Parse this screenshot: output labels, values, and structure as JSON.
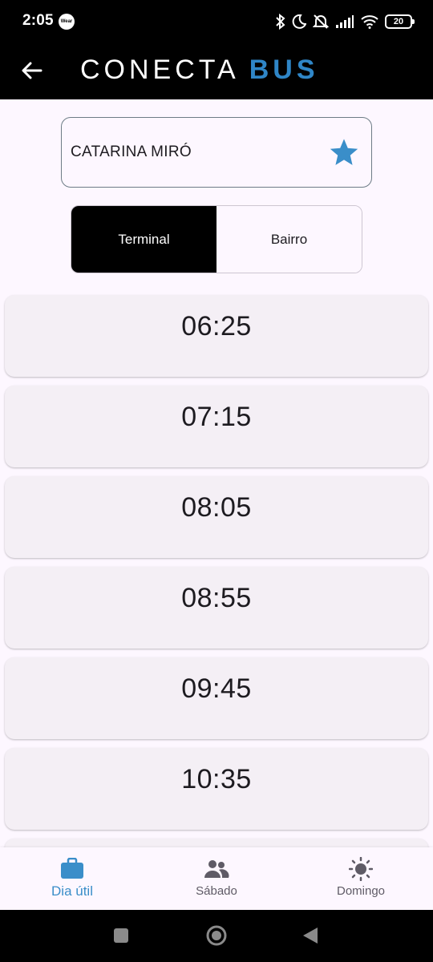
{
  "status_bar": {
    "time": "2:05",
    "wear_label": "Wear",
    "battery": "20",
    "icons": [
      "bluetooth-icon",
      "moon-icon",
      "silent-icon",
      "signal-icon",
      "wifi-icon",
      "battery-icon"
    ]
  },
  "app_bar": {
    "back_icon": "arrow-left-icon",
    "logo_main": "CONECTA",
    "logo_accent": "BUS",
    "colors": {
      "background": "#000000",
      "accent": "#2f86c7"
    }
  },
  "route": {
    "name": "CATARINA MIRÓ",
    "favorite_icon": "star-icon",
    "favorite_color": "#3a8ec9"
  },
  "direction": {
    "options": [
      {
        "label": "Terminal",
        "selected": true
      },
      {
        "label": "Bairro",
        "selected": false
      }
    ]
  },
  "times": [
    "06:25",
    "07:15",
    "08:05",
    "08:55",
    "09:45",
    "10:35"
  ],
  "bottom_nav": {
    "items": [
      {
        "label": "Dia útil",
        "icon": "briefcase-icon",
        "active": true
      },
      {
        "label": "Sábado",
        "icon": "people-icon",
        "active": false
      },
      {
        "label": "Domingo",
        "icon": "sun-icon",
        "active": false
      }
    ],
    "active_color": "#3a8ec9"
  },
  "system_nav": {
    "buttons": [
      "recents-square-icon",
      "home-circle-icon",
      "back-triangle-icon"
    ]
  }
}
